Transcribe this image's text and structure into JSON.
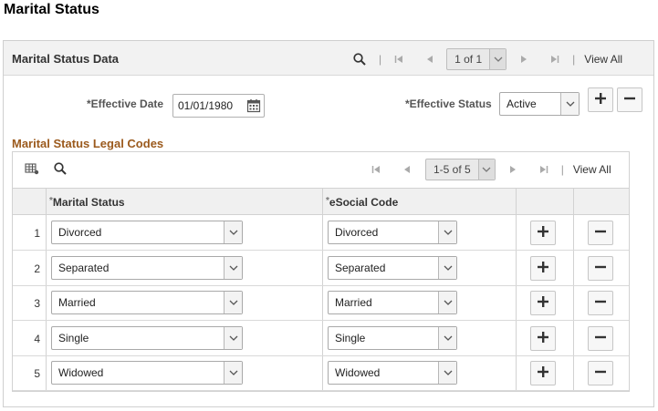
{
  "page": {
    "title": "Marital Status"
  },
  "header": {
    "title": "Marital Status Data",
    "pager_text": "1 of 1",
    "view_all": "View All"
  },
  "fields": {
    "effective_date_label": "*Effective Date",
    "effective_date_value": "01/01/1980",
    "effective_status_label": "*Effective Status",
    "effective_status_value": "Active"
  },
  "grid": {
    "title": "Marital Status Legal Codes",
    "pager_text": "1-5 of 5",
    "view_all": "View All",
    "columns": {
      "marital_status": "Marital Status",
      "esocial_code": "eSocial Code",
      "req_mark": "*"
    },
    "rows": [
      {
        "num": "1",
        "marital_status": "Divorced",
        "esocial": "Divorced"
      },
      {
        "num": "2",
        "marital_status": "Separated",
        "esocial": "Separated"
      },
      {
        "num": "3",
        "marital_status": "Married",
        "esocial": "Married"
      },
      {
        "num": "4",
        "marital_status": "Single",
        "esocial": "Single"
      },
      {
        "num": "5",
        "marital_status": "Widowed",
        "esocial": "Widowed"
      }
    ]
  },
  "icons": {
    "search": "search-icon",
    "first": "first-page-icon",
    "prev": "previous-icon",
    "next": "next-icon",
    "last": "last-page-icon",
    "calendar": "calendar-icon",
    "add": "plus-icon",
    "remove": "minus-icon",
    "personalize": "grid-settings-icon",
    "dropdown": "chevron-down-icon"
  },
  "colors": {
    "section_title": "#9b5a1d",
    "header_bg": "#f2f2f2"
  }
}
